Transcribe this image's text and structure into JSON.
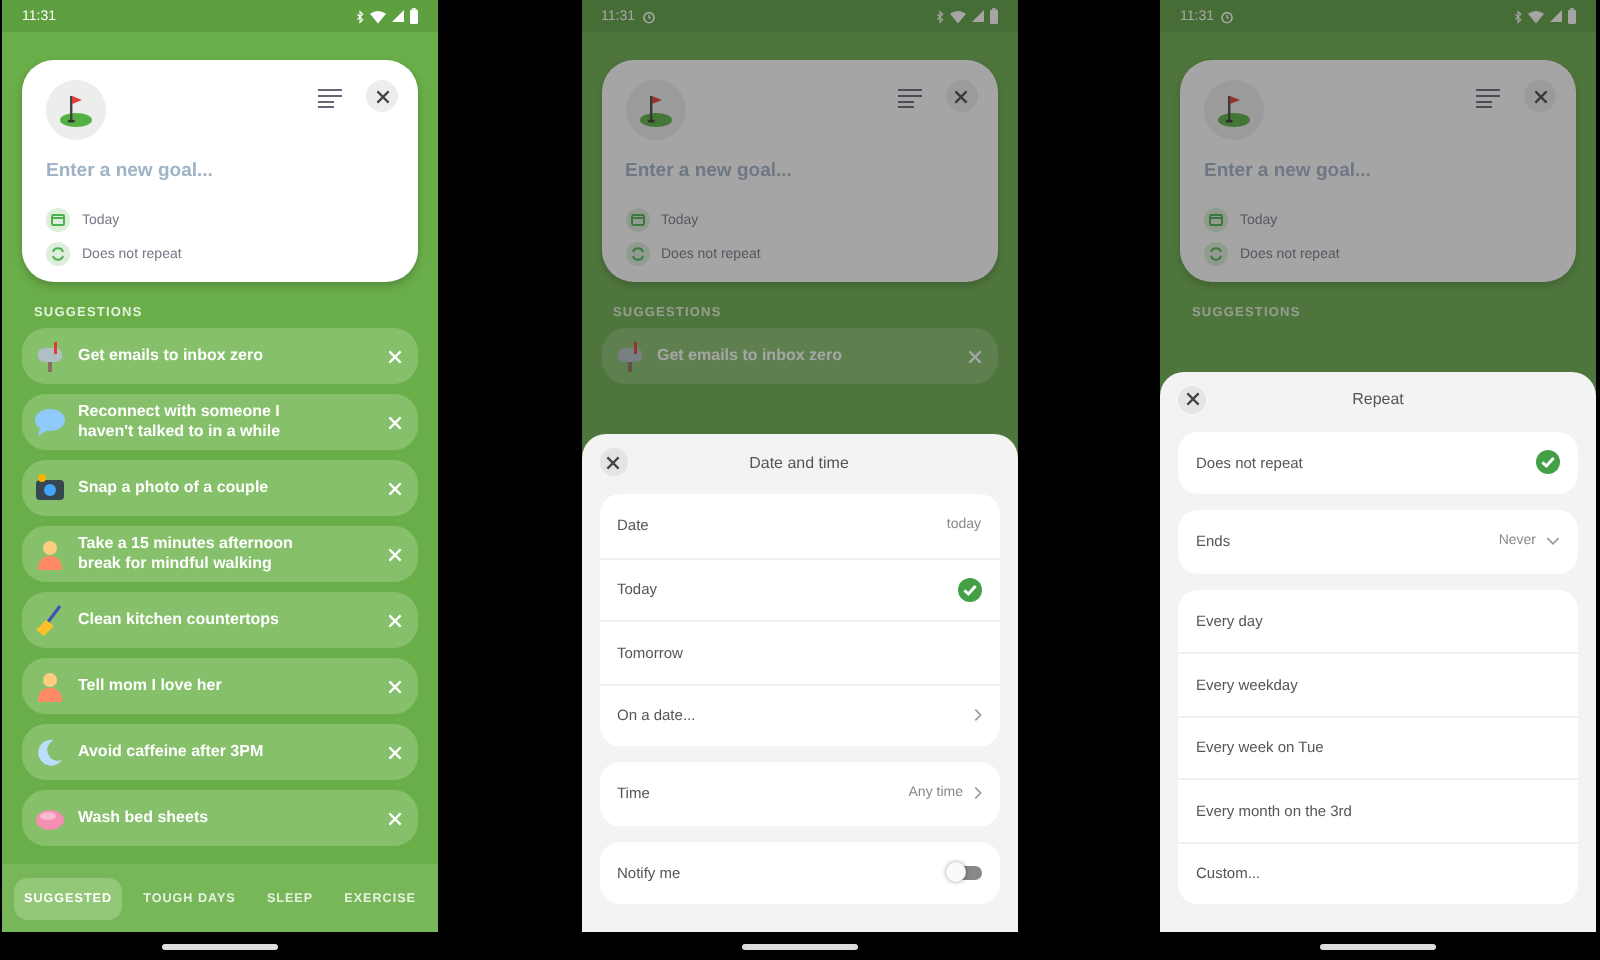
{
  "screens": [
    {
      "status": {
        "time": "11:31",
        "alarm": false
      },
      "dimmed": false,
      "goal_card": {
        "placeholder": "Enter a new goal...",
        "date": "Today",
        "repeat": "Does not repeat"
      },
      "suggestions_heading": "SUGGESTIONS",
      "suggestions": [
        {
          "text": "Get emails to inbox zero"
        },
        {
          "text": "Reconnect with someone I haven't talked to in a while"
        },
        {
          "text": "Snap a photo of a couple"
        },
        {
          "text": "Take a 15 minutes afternoon break for mindful walking"
        },
        {
          "text": "Clean kitchen countertops"
        },
        {
          "text": "Tell mom I love her"
        },
        {
          "text": "Avoid caffeine after 3PM"
        },
        {
          "text": "Wash bed sheets"
        }
      ],
      "tabs": [
        {
          "label": "SUGGESTED",
          "selected": true
        },
        {
          "label": "TOUGH DAYS",
          "selected": false
        },
        {
          "label": "SLEEP",
          "selected": false
        },
        {
          "label": "EXERCISE",
          "selected": false
        }
      ]
    },
    {
      "status": {
        "time": "11:31",
        "alarm": true
      },
      "dimmed": true,
      "goal_card": {
        "placeholder": "Enter a new goal...",
        "date": "Today",
        "repeat": "Does not repeat"
      },
      "suggestions_heading": "SUGGESTIONS",
      "suggestions": [
        {
          "text": "Get emails to inbox zero"
        }
      ],
      "sheet": {
        "title": "Date and time",
        "groups": [
          {
            "rows": [
              {
                "kind": "value",
                "label": "Date",
                "value": "today"
              },
              {
                "kind": "option",
                "label": "Today",
                "selected": true
              },
              {
                "kind": "option",
                "label": "Tomorrow",
                "selected": false
              },
              {
                "kind": "link",
                "label": "On a date..."
              }
            ]
          },
          {
            "rows": [
              {
                "kind": "link",
                "label": "Time",
                "value": "Any time"
              }
            ]
          },
          {
            "rows": [
              {
                "kind": "toggle",
                "label": "Notify me",
                "on": false
              }
            ]
          }
        ]
      }
    },
    {
      "status": {
        "time": "11:31",
        "alarm": true
      },
      "dimmed": true,
      "goal_card": {
        "placeholder": "Enter a new goal...",
        "date": "Today",
        "repeat": "Does not repeat"
      },
      "suggestions_heading": "SUGGESTIONS",
      "sheet": {
        "title": "Repeat",
        "groups": [
          {
            "rows": [
              {
                "kind": "option",
                "label": "Does not repeat",
                "selected": true
              }
            ]
          },
          {
            "rows": [
              {
                "kind": "dropdown",
                "label": "Ends",
                "value": "Never"
              }
            ]
          },
          {
            "rows": [
              {
                "kind": "option",
                "label": "Every day",
                "selected": false
              },
              {
                "kind": "option",
                "label": "Every weekday",
                "selected": false
              },
              {
                "kind": "option",
                "label": "Every week on Tue",
                "selected": false
              },
              {
                "kind": "option",
                "label": "Every month on the 3rd",
                "selected": false
              },
              {
                "kind": "option",
                "label": "Custom...",
                "selected": false
              }
            ]
          }
        ]
      }
    }
  ]
}
